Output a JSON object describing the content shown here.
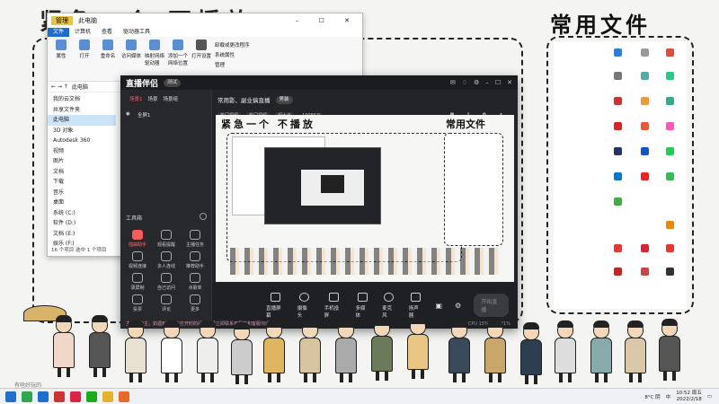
{
  "desktop": {
    "heading_left": "紧急一个 不播放",
    "heading_right": "常用文件",
    "watermark": "有啥好玩的"
  },
  "explorer": {
    "title_tab": "管理",
    "title_path": "此电脑",
    "tabs": [
      "文件",
      "计算机",
      "查看",
      "驱动器工具"
    ],
    "ribbon": [
      "属性",
      "打开",
      "重命名",
      "访问媒体",
      "映射网络驱动器",
      "添加一个网络位置",
      "打开设置",
      "卸载或更改程序",
      "系统属性",
      "管理"
    ],
    "address": "此电脑",
    "side": [
      "我的云文档",
      "共享文件夹",
      "此电脑",
      "3D 对象",
      "Autodesk 360",
      "视频",
      "图片",
      "文档",
      "下载",
      "音乐",
      "桌面",
      "系统 (C:)",
      "软件 (D:)",
      "文档 (E:)",
      "娱乐 (F:)",
      "TOSHIBA EXT (",
      "网络"
    ],
    "status": "16 个项目    选中 1 个项目"
  },
  "app": {
    "logo": "直播伴侣",
    "badge": "测试",
    "tabs": [
      "场景1",
      "场景",
      "场景组"
    ],
    "scene_item": "全屏1",
    "stream_title": "常用影、副业搞直播",
    "stream_tag": "男装",
    "subtabs": [
      "热门视频",
      "热门视频",
      "观大光"
    ],
    "viewers": "10086万",
    "uid": "抖音号 10086741",
    "tools_label": "工具箱",
    "tools": [
      "插曲助手",
      "观看提醒",
      "主播任务",
      "视频连接",
      "多人连线",
      "推荐助手",
      "录屏制",
      "自己访问",
      "点歌单",
      "投票",
      "评论",
      "更多"
    ],
    "bottom": [
      "直播屏幕",
      "摄像头",
      "手机投屏",
      "多媒体",
      "麦克风",
      "扬声器"
    ],
    "go_live": "开始直播",
    "notice": "主要助力主，如遇到影音点打开时的问题，请立即联系客服并和客服沟通",
    "cpu": "CPU 15% 内存 31%"
  },
  "taskbar": {
    "temp": "8°C 阴",
    "ime": "中",
    "time": "10:52 周五",
    "date": "2022/2/18"
  }
}
